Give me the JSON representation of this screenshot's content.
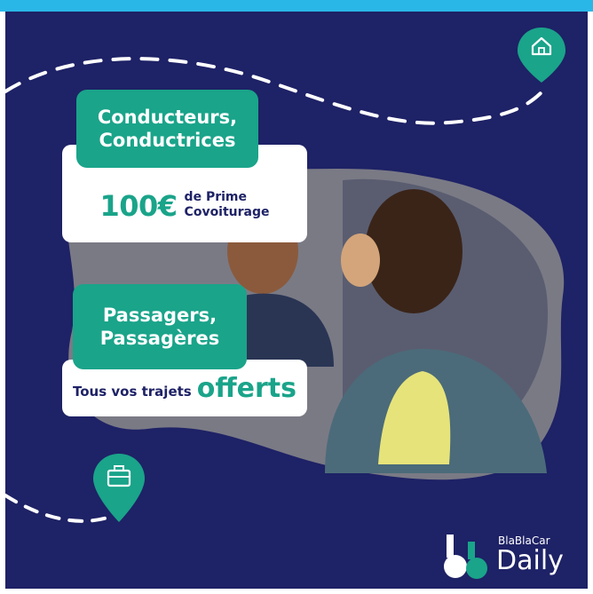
{
  "driver": {
    "label_line1": "Conducteurs,",
    "label_line2": "Conductrices",
    "amount": "100€",
    "prime_line1": "de Prime",
    "prime_line2": "Covoiturage"
  },
  "passenger": {
    "label_line1": "Passagers,",
    "label_line2": "Passagères",
    "trips_text": "Tous vos trajets",
    "offerts": "offerts"
  },
  "brand": {
    "small": "BlaBlaCar",
    "big": "Daily"
  },
  "icons": {
    "home": "home-pin-icon",
    "work": "briefcase-pin-icon",
    "logo": "blablacar-logo-icon"
  },
  "colors": {
    "background": "#1e2266",
    "accent": "#1aa48a",
    "top_bar": "#29b7e8"
  }
}
